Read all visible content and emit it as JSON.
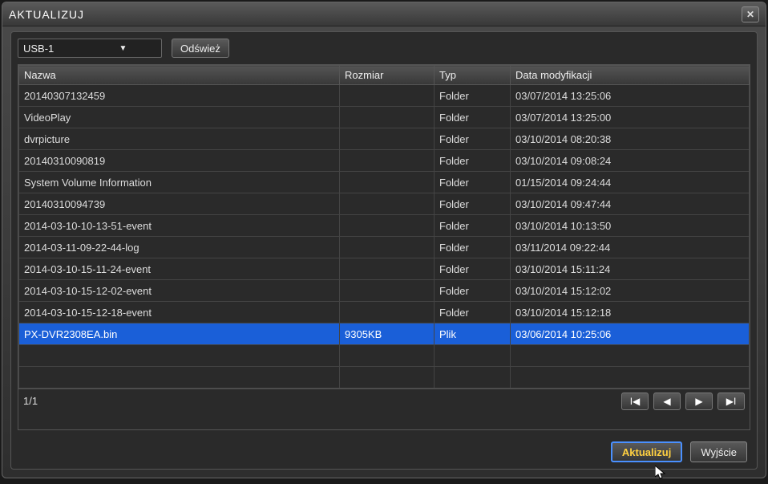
{
  "window": {
    "title": "AKTUALIZUJ"
  },
  "toolbar": {
    "device_selected": "USB-1",
    "refresh_label": "Odśwież"
  },
  "table": {
    "headers": {
      "name": "Nazwa",
      "size": "Rozmiar",
      "type": "Typ",
      "date": "Data modyfikacji"
    },
    "rows": [
      {
        "name": "20140307132459",
        "size": "",
        "type": "Folder",
        "date": "03/07/2014 13:25:06",
        "selected": false
      },
      {
        "name": "VideoPlay",
        "size": "",
        "type": "Folder",
        "date": "03/07/2014 13:25:00",
        "selected": false
      },
      {
        "name": "dvrpicture",
        "size": "",
        "type": "Folder",
        "date": "03/10/2014 08:20:38",
        "selected": false
      },
      {
        "name": "20140310090819",
        "size": "",
        "type": "Folder",
        "date": "03/10/2014 09:08:24",
        "selected": false
      },
      {
        "name": "System Volume Information",
        "size": "",
        "type": "Folder",
        "date": "01/15/2014 09:24:44",
        "selected": false
      },
      {
        "name": "20140310094739",
        "size": "",
        "type": "Folder",
        "date": "03/10/2014 09:47:44",
        "selected": false
      },
      {
        "name": "2014-03-10-10-13-51-event",
        "size": "",
        "type": "Folder",
        "date": "03/10/2014 10:13:50",
        "selected": false
      },
      {
        "name": "2014-03-11-09-22-44-log",
        "size": "",
        "type": "Folder",
        "date": "03/11/2014 09:22:44",
        "selected": false
      },
      {
        "name": "2014-03-10-15-11-24-event",
        "size": "",
        "type": "Folder",
        "date": "03/10/2014 15:11:24",
        "selected": false
      },
      {
        "name": "2014-03-10-15-12-02-event",
        "size": "",
        "type": "Folder",
        "date": "03/10/2014 15:12:02",
        "selected": false
      },
      {
        "name": "2014-03-10-15-12-18-event",
        "size": "",
        "type": "Folder",
        "date": "03/10/2014 15:12:18",
        "selected": false
      },
      {
        "name": "PX-DVR2308EA.bin",
        "size": "9305KB",
        "type": "Plik",
        "date": "03/06/2014 10:25:06",
        "selected": true
      }
    ],
    "empty_rows": 2,
    "page_info": "1/1"
  },
  "nav": {
    "first_icon": "first-icon",
    "prev_icon": "prev-icon",
    "next_icon": "next-icon",
    "last_icon": "last-icon"
  },
  "actions": {
    "update_label": "Aktualizuj",
    "exit_label": "Wyjście"
  }
}
